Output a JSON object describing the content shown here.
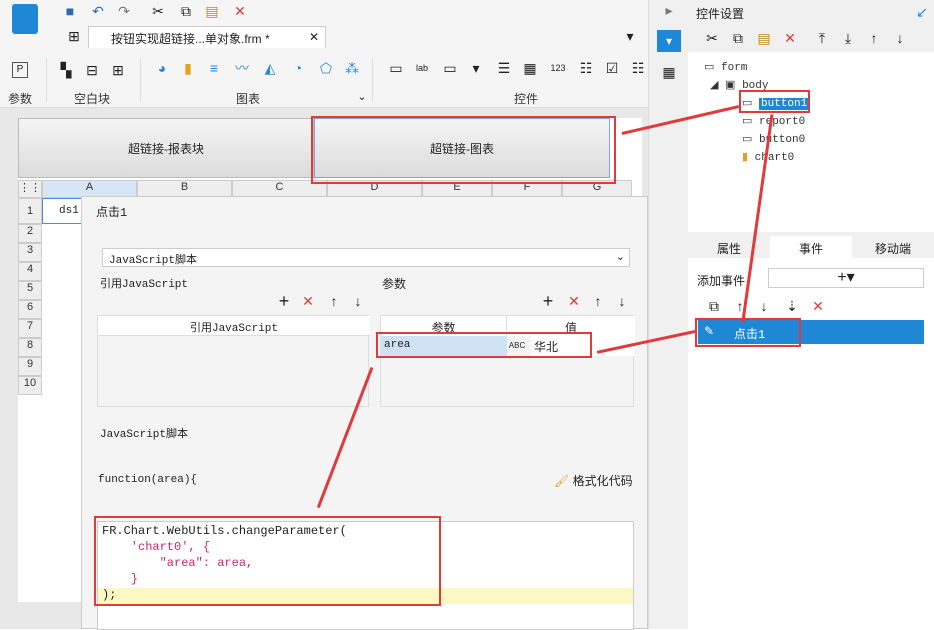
{
  "toolbar": {
    "tab_title": "按钮实现超链接...单对象.frm *",
    "groups": [
      "参数",
      "空白块",
      "图表",
      "控件"
    ]
  },
  "canvas": {
    "buttons": [
      "超链接-报表块",
      "超链接-图表"
    ],
    "columns": [
      "A",
      "B",
      "C",
      "D",
      "E",
      "F",
      "G"
    ],
    "rows": [
      "1",
      "2",
      "3",
      "4",
      "5",
      "6",
      "7",
      "8",
      "9",
      "10"
    ],
    "cell_a1": "ds1."
  },
  "dialog": {
    "title": "点击1",
    "type_select": "JavaScript脚本",
    "ref_label": "引用JavaScript",
    "ref_col": "引用JavaScript",
    "params_label": "参数",
    "param_headers": [
      "参数",
      "值"
    ],
    "param_name": "area",
    "param_value": "华北",
    "script_label": "JavaScript脚本",
    "func_sig": "function(area){",
    "format_btn": "格式化代码",
    "code": [
      "FR.Chart.WebUtils.changeParameter(",
      "    'chart0', {",
      "        \"area\": area,",
      "    }",
      ");"
    ]
  },
  "right_panel": {
    "title": "控件设置",
    "tree": [
      "form",
      "body",
      "button1",
      "report0",
      "button0",
      "chart0"
    ],
    "tabs": [
      "属性",
      "事件",
      "移动端"
    ],
    "add_event": "添加事件",
    "event_item": "点击1"
  }
}
